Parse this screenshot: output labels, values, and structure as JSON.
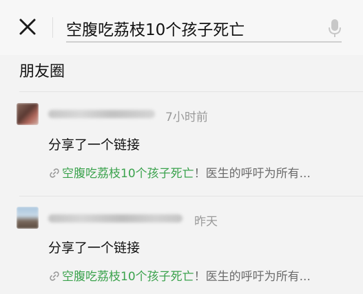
{
  "search": {
    "query": "空腹吃荔枝10个孩子死亡"
  },
  "section": {
    "title": "朋友圈"
  },
  "results": [
    {
      "time": "7小时前",
      "shared_label": "分享了一个链接",
      "link_highlight": "空腹吃荔枝10个孩子死亡",
      "link_rest": "！医生的呼吁为所有..."
    },
    {
      "time": "昨天",
      "shared_label": "分享了一个链接",
      "link_highlight": "空腹吃荔枝10个孩子死亡",
      "link_rest": "！医生的呼吁为所有..."
    }
  ],
  "colors": {
    "accent_green": "#3aa24c",
    "muted": "#999999"
  },
  "icons": {
    "close": "close-icon",
    "mic": "mic-icon",
    "link": "link-icon"
  }
}
